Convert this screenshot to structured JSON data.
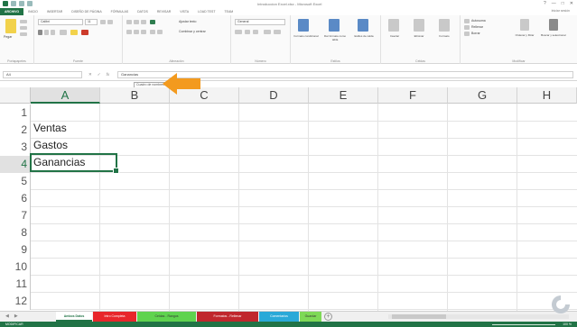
{
  "window": {
    "title": "Introduccion Excel.xlsx - Microsoft Excel",
    "controls": [
      "?",
      "—",
      "□",
      "✕"
    ]
  },
  "ribbon": {
    "tabs": [
      "ARCHIVO",
      "INICIO",
      "INSERTAR",
      "DISEÑO DE PÁGINA",
      "FÓRMULAS",
      "DATOS",
      "REVISAR",
      "VISTA",
      "LOAD TEST",
      "TEAM"
    ],
    "active_tab": "ARCHIVO",
    "user": "Iniciar sesión",
    "groups": [
      "Portapapeles",
      "Fuente",
      "Alineación",
      "Número",
      "Estilos",
      "Celdas",
      "Modificar"
    ],
    "font_name": "Calibri",
    "font_size": "11",
    "number_format": "General",
    "wrap_text": "Ajustar texto",
    "merge_center": "Combinar y centrar",
    "format_conditional": "Formato condicional",
    "format_table": "Dar formato como tabla",
    "cell_styles": "Estilos de celda",
    "insert": "Insertar",
    "delete": "Eliminar",
    "format": "Formato",
    "autosum": "Autosuma",
    "fill": "Rellenar",
    "clear": "Borrar",
    "sort_filter": "Ordenar y filtrar",
    "find_select": "Buscar y seleccionar",
    "paste": "Pegar"
  },
  "formula_bar": {
    "name_box": "A4",
    "cancel": "✕",
    "enter": "✓",
    "fx": "fx",
    "content": "Ganancias",
    "tooltip": "Cuadro de nombres"
  },
  "sheet": {
    "columns": [
      "A",
      "B",
      "C",
      "D",
      "E",
      "F",
      "G",
      "H"
    ],
    "rows": [
      "1",
      "2",
      "3",
      "4",
      "5",
      "6",
      "7",
      "8",
      "9",
      "10",
      "11",
      "12"
    ],
    "cells": {
      "A2": "Ventas",
      "A3": "Gastos",
      "A4": "Ganancias"
    },
    "active_cell": "A4"
  },
  "sheet_tabs": [
    {
      "label": "Ambos Datos",
      "color": "#ffffff",
      "active": true
    },
    {
      "label": "Intro Completa",
      "color": "#e8262b"
    },
    {
      "label": "Celdas - Rangos",
      "color": "#5fd34f"
    },
    {
      "label": "Formatos - Rellenar",
      "color": "#c0272d"
    },
    {
      "label": "Comentarios",
      "color": "#2aa9d8"
    },
    {
      "label": "Guardar",
      "color": "#7ed957"
    }
  ],
  "status": {
    "mode": "MODIFICAR",
    "zoom": "100 %"
  },
  "colors": {
    "excel_green": "#217346",
    "arrow_orange": "#f39a1e"
  }
}
